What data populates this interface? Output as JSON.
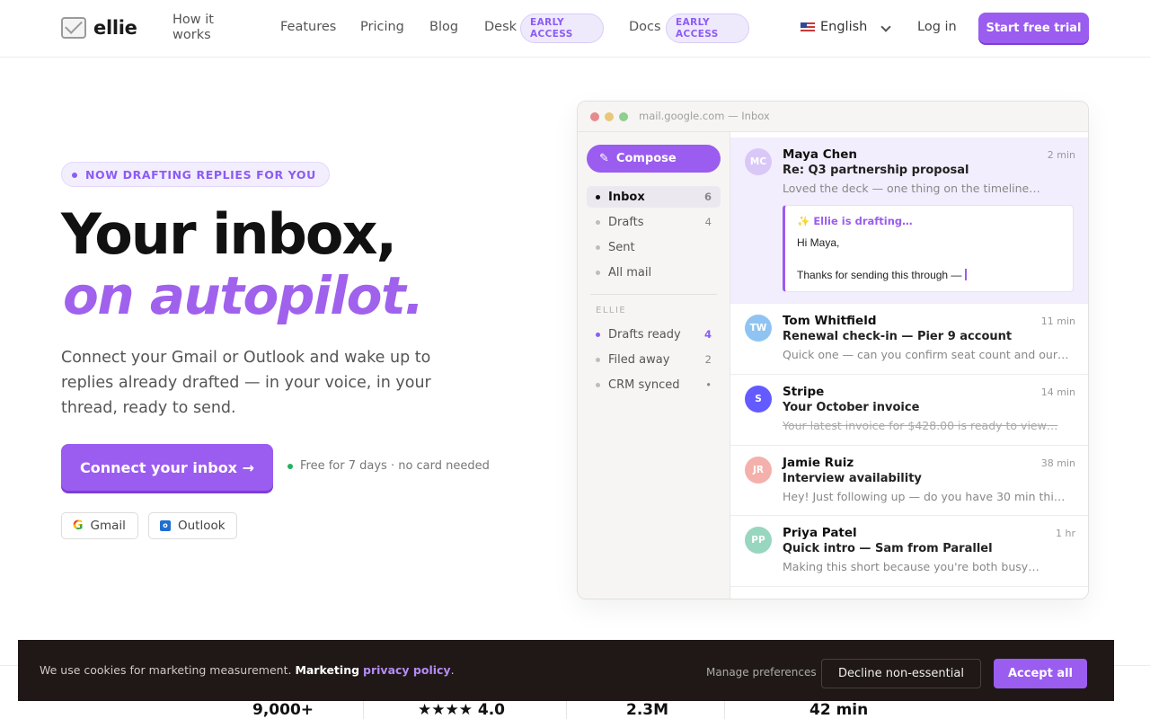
{
  "nav": {
    "logo": "ellie",
    "links": [
      "How it works",
      "Features",
      "Pricing",
      "Blog",
      "Desk",
      "Docs"
    ],
    "early_access": "EARLY ACCESS",
    "language": "English",
    "login": "Log in",
    "cta": "Start free trial"
  },
  "hero": {
    "badge": "NOW DRAFTING REPLIES FOR YOU",
    "title_line1": "Your inbox,",
    "title_line2": "on autopilot.",
    "subtitle": "Connect your Gmail or Outlook and wake up to replies already drafted — in your voice, in your thread, ready to send.",
    "cta": "Connect your inbox →",
    "free_note": "Free for 7 days · no card needed",
    "providers": [
      "Gmail",
      "Outlook"
    ]
  },
  "mock": {
    "url": "mail.google.com — Inbox",
    "compose": "Compose",
    "folders": [
      {
        "label": "Inbox",
        "count": "6"
      },
      {
        "label": "Drafts",
        "count": "4"
      },
      {
        "label": "Sent",
        "count": ""
      },
      {
        "label": "All mail",
        "count": ""
      }
    ],
    "section_label": "ELLIE",
    "ellie_folders": [
      {
        "label": "Drafts ready",
        "count": "4"
      },
      {
        "label": "Filed away",
        "count": "2"
      },
      {
        "label": "CRM synced",
        "count": "•"
      }
    ],
    "messages": [
      {
        "initials": "MC",
        "from": "Maya Chen",
        "time": "2 min",
        "subject": "Re: Q3 partnership proposal",
        "preview": "Loved the deck — one thing on the timeline…",
        "color": "#d9c8f7"
      },
      {
        "initials": "TW",
        "from": "Tom Whitfield",
        "time": "11 min",
        "subject": "Renewal check-in — Pier 9 account",
        "preview": "Quick one — can you confirm seat count and our ren…",
        "color": "#8fc4f2"
      },
      {
        "initials": "S",
        "from": "Stripe",
        "time": "14 min",
        "subject": "Your October invoice",
        "preview": "Your latest invoice for $428.00 is ready to view…",
        "color": "#635bff"
      },
      {
        "initials": "JR",
        "from": "Jamie Ruiz",
        "time": "38 min",
        "subject": "Interview availability",
        "preview": "Hey! Just following up — do you have 30 min this we…",
        "color": "#f4b0aa"
      },
      {
        "initials": "PP",
        "from": "Priya Patel",
        "time": "1 hr",
        "subject": "Quick intro — Sam from Parallel",
        "preview": "Making this short because you're both busy…",
        "color": "#98d6bf"
      }
    ],
    "draft": {
      "label": "✨ Ellie is drafting…",
      "line1": "Hi Maya,",
      "line2": "Thanks for sending this through —"
    }
  },
  "stats": [
    "9,000+",
    "★★★★ 4.0",
    "2.3M",
    "42 min"
  ],
  "cookie": {
    "text": "We use cookies for marketing measurement.",
    "bold": "Marketing",
    "link": "privacy policy",
    "period": ".",
    "manage": "Manage preferences",
    "decline": "Decline non-essential",
    "accept": "Accept all"
  }
}
